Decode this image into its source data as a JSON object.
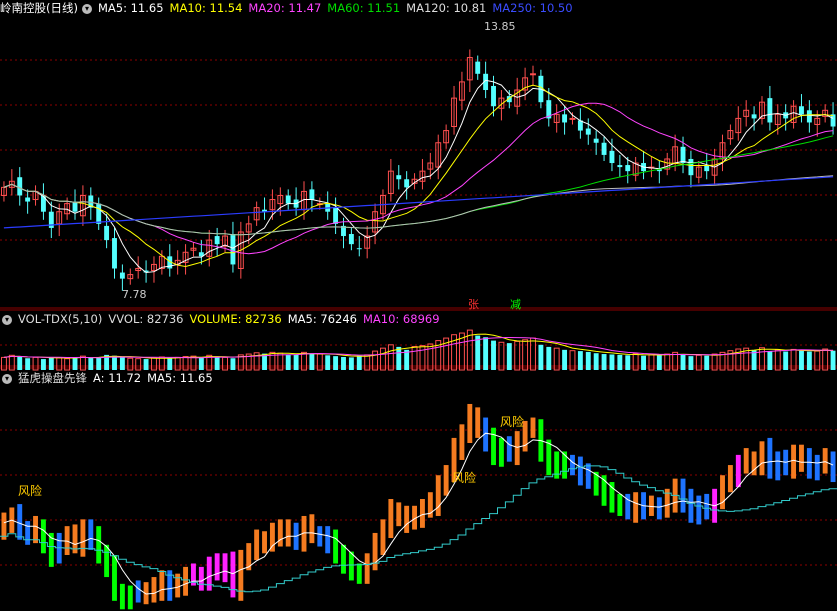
{
  "colors": {
    "up": "#ff4f4f",
    "down": "#54ffff",
    "ma5": "#ffffff",
    "ma10": "#ffff00",
    "ma20": "#ff44ff",
    "ma60": "#00dd00",
    "ma120": "#bbbbbb",
    "ma250": "#2b3cff",
    "grid": "#8b0000",
    "orange": "#f47b20",
    "green": "#00ff00",
    "blue": "#1e73ff",
    "magenta": "#ff22ff",
    "cyan": "#33cccc",
    "risk_text": "#ffcc00"
  },
  "main_panel": {
    "title": "岭南控股(日线)",
    "legend": [
      {
        "key": "ma5",
        "label": "MA5: 11.65",
        "color": "#ffffff"
      },
      {
        "key": "ma10",
        "label": "MA10: 11.54",
        "color": "#ffff00"
      },
      {
        "key": "ma20",
        "label": "MA20: 11.47",
        "color": "#ff44ff"
      },
      {
        "key": "ma60",
        "label": "MA60: 11.51",
        "color": "#00dd00"
      },
      {
        "key": "ma120",
        "label": "MA120: 10.81",
        "color": "#dddddd"
      },
      {
        "key": "ma250",
        "label": "MA250: 10.50",
        "color": "#3a4cff"
      }
    ],
    "high_label": "13.85",
    "low_label": "7.78",
    "tags": [
      {
        "text": "张",
        "color": "#ff3333"
      },
      {
        "text": "减",
        "color": "#00ff00"
      }
    ]
  },
  "volume_panel": {
    "title": "VOL-TDX(5,10)",
    "legend": [
      {
        "label": "VVOL: 82736",
        "color": "#dddddd"
      },
      {
        "label": "VOLUME: 82736",
        "color": "#ffff00"
      },
      {
        "label": "MA5: 76246",
        "color": "#ffffff"
      },
      {
        "label": "MA10: 68969",
        "color": "#ff44ff"
      }
    ]
  },
  "indicator_panel": {
    "title": "猛虎操盘先锋",
    "legend": [
      {
        "label": "A: 11.72",
        "color": "#ffffff"
      },
      {
        "label": "MA5: 11.65",
        "color": "#ffffff"
      }
    ],
    "risk_label": "风险",
    "risk_labels": [
      "风险",
      "风险",
      "风险"
    ]
  },
  "chart_data": {
    "type": "candlestick",
    "price_range": [
      7.3,
      14.4
    ],
    "close": [
      10.2,
      10.35,
      10.0,
      9.85,
      10.1,
      9.6,
      9.2,
      9.6,
      9.8,
      9.6,
      10.0,
      9.7,
      9.3,
      8.9,
      8.2,
      7.95,
      8.05,
      8.2,
      8.1,
      8.3,
      8.5,
      8.2,
      8.4,
      8.6,
      8.7,
      8.5,
      8.9,
      8.8,
      9.0,
      8.3,
      9.1,
      9.3,
      9.7,
      9.6,
      9.9,
      10.0,
      9.8,
      9.7,
      10.1,
      9.9,
      9.8,
      9.6,
      9.3,
      9.0,
      8.8,
      8.7,
      9.0,
      9.6,
      10.0,
      10.6,
      10.4,
      10.2,
      10.4,
      10.6,
      10.8,
      11.3,
      11.6,
      12.4,
      12.8,
      13.4,
      13.0,
      12.6,
      12.2,
      12.4,
      12.3,
      12.6,
      12.9,
      13.0,
      12.3,
      11.9,
      12.0,
      11.8,
      11.9,
      11.6,
      11.5,
      11.3,
      11.0,
      10.8,
      10.7,
      10.6,
      10.8,
      10.6,
      10.7,
      10.6,
      10.9,
      11.2,
      10.8,
      10.5,
      10.7,
      10.6,
      10.9,
      11.3,
      11.6,
      11.9,
      12.1,
      11.9,
      12.3,
      11.8,
      12.0,
      11.9,
      12.2,
      12.0,
      11.8,
      11.9,
      12.1,
      11.7
    ],
    "volume_scale": [
      0,
      100000
    ],
    "volume": [
      30000,
      35000,
      32000,
      28000,
      30000,
      26000,
      31000,
      29000,
      27000,
      30000,
      33000,
      29000,
      31000,
      36000,
      34000,
      30000,
      28000,
      27000,
      26000,
      29000,
      31000,
      28000,
      30000,
      32000,
      33000,
      29000,
      35000,
      31000,
      30000,
      28000,
      36000,
      38000,
      41000,
      39000,
      42000,
      40000,
      37000,
      36000,
      42000,
      39000,
      38000,
      35000,
      33000,
      31000,
      30000,
      34000,
      36000,
      45000,
      52000,
      60000,
      55000,
      48000,
      56000,
      58000,
      62000,
      70000,
      76000,
      84000,
      88000,
      95000,
      82000,
      78000,
      70000,
      66000,
      64000,
      68000,
      72000,
      76000,
      60000,
      55000,
      52000,
      48000,
      46000,
      45000,
      43000,
      40000,
      38000,
      37000,
      36000,
      35000,
      39000,
      34000,
      36000,
      35000,
      38000,
      42000,
      36000,
      33000,
      35000,
      34000,
      38000,
      42000,
      46000,
      50000,
      52000,
      47000,
      53000,
      45000,
      48000,
      44000,
      49000,
      46000,
      44000,
      45000,
      50000,
      46000
    ],
    "indicator_range": [
      7.6,
      14.2
    ]
  }
}
